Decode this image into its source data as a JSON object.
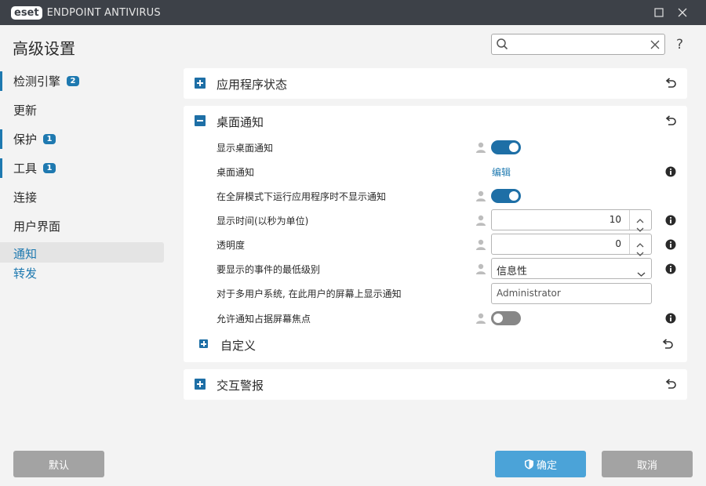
{
  "window": {
    "logo": "eset",
    "product": "ENDPOINT ANTIVIRUS",
    "icons": [
      "maximize-icon",
      "close-icon"
    ]
  },
  "header": {
    "title": "高级设置",
    "search_value": "",
    "help": "?"
  },
  "nav": {
    "items": [
      {
        "label": "检测引擎",
        "badge": "2"
      },
      {
        "label": "更新"
      },
      {
        "label": "保护",
        "badge": "1"
      },
      {
        "label": "工具",
        "badge": "1"
      },
      {
        "label": "连接"
      },
      {
        "label": "用户界面"
      }
    ],
    "active": "通知",
    "subitem": "转发"
  },
  "sections": {
    "app_status": "应用程序状态",
    "desktop": {
      "title": "桌面通知",
      "rows": {
        "show_desktop": {
          "label": "显示桌面通知",
          "on": true
        },
        "desktop_notify": {
          "label": "桌面通知",
          "link": "编辑"
        },
        "fullscreen": {
          "label": "在全屏模式下运行应用程序时不显示通知",
          "on": true
        },
        "display_time": {
          "label": "显示时间(以秒为单位)",
          "value": "10"
        },
        "transparency": {
          "label": "透明度",
          "value": "0"
        },
        "min_level": {
          "label": "要显示的事件的最低级别",
          "value": "信息性"
        },
        "multi_user": {
          "label": "对于多用户系统, 在此用户的屏幕上显示通知",
          "value": "Administrator"
        },
        "focus": {
          "label": "允许通知占据屏幕焦点",
          "on": false
        }
      },
      "custom": "自定义"
    },
    "interactive": "交互警报"
  },
  "footer": {
    "default": "默认",
    "ok": "确定",
    "cancel": "取消"
  },
  "colors": {
    "accent": "#1e6fa6",
    "titlebar": "#3d4148",
    "ok_button": "#4ba3d8",
    "gray_button": "#a3a3a3"
  }
}
